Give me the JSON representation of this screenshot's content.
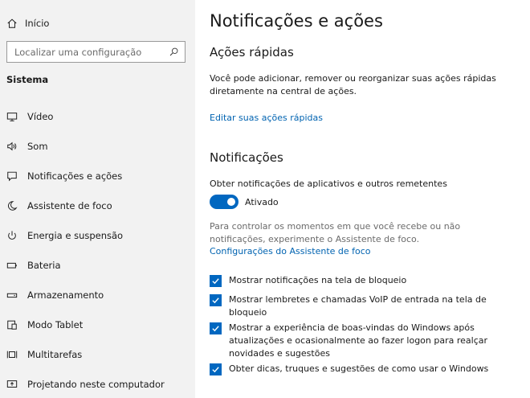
{
  "sidebar": {
    "home_label": "Início",
    "search_placeholder": "Localizar uma configuração",
    "section": "Sistema",
    "items": [
      {
        "label": "Vídeo",
        "icon": "monitor-icon"
      },
      {
        "label": "Som",
        "icon": "speaker-icon"
      },
      {
        "label": "Notificações e ações",
        "icon": "notification-icon"
      },
      {
        "label": "Assistente de foco",
        "icon": "moon-icon"
      },
      {
        "label": "Energia e suspensão",
        "icon": "power-icon"
      },
      {
        "label": "Bateria",
        "icon": "battery-icon"
      },
      {
        "label": "Armazenamento",
        "icon": "storage-icon"
      },
      {
        "label": "Modo Tablet",
        "icon": "tablet-icon"
      },
      {
        "label": "Multitarefas",
        "icon": "multitask-icon"
      },
      {
        "label": "Projetando neste computador",
        "icon": "project-icon"
      }
    ]
  },
  "main": {
    "title": "Notificações e ações",
    "quick_actions": {
      "heading": "Ações rápidas",
      "description_line1": "Você pode adicionar, remover ou reorganizar suas ações rápidas",
      "description_line2": "diretamente na central de ações.",
      "edit_link": "Editar suas ações rápidas"
    },
    "notifications": {
      "heading": "Notificações",
      "get_notifications_label": "Obter notificações de aplicativos e outros remetentes",
      "toggle_state": "Ativado",
      "toggle_on": true,
      "focus_note_line1": "Para controlar os momentos em que você recebe ou não",
      "focus_note_line2": "notificações, experimente o Assistente de foco.",
      "focus_link": "Configurações do Assistente de foco",
      "checkboxes": [
        {
          "label": "Mostrar notificações na tela de bloqueio",
          "checked": true
        },
        {
          "label": "Mostrar lembretes e chamadas VoIP de entrada na tela de bloqueio",
          "checked": true
        },
        {
          "label": "Mostrar a experiência de boas-vindas do Windows após atualizações e ocasionalmente ao fazer logon para realçar novidades e sugestões",
          "checked": true
        },
        {
          "label": "Obter dicas, truques e sugestões de como usar o Windows",
          "checked": true
        }
      ]
    }
  },
  "colors": {
    "accent": "#0067c0",
    "link": "#0063b1",
    "sidebar_bg": "#f2f2f2"
  }
}
